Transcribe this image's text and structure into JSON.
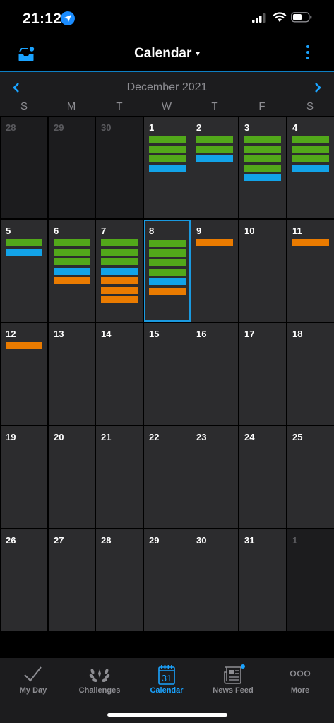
{
  "status": {
    "time": "21:12"
  },
  "header": {
    "title": "Calendar",
    "caret": "▾"
  },
  "calendar": {
    "month_label": "December 2021",
    "prev_icon": "chevron-left-icon",
    "next_icon": "chevron-right-icon",
    "weekdays": [
      "S",
      "M",
      "T",
      "W",
      "T",
      "F",
      "S"
    ],
    "selected_day": 8,
    "colors": {
      "green": "#52a81a",
      "blue": "#12a3e8",
      "orange": "#ea7b00"
    },
    "days": [
      {
        "label": "28",
        "other": true,
        "events": []
      },
      {
        "label": "29",
        "other": true,
        "events": []
      },
      {
        "label": "30",
        "other": true,
        "events": []
      },
      {
        "label": "1",
        "events": [
          "green",
          "green",
          "green",
          "blue"
        ]
      },
      {
        "label": "2",
        "events": [
          "green",
          "green",
          "blue"
        ]
      },
      {
        "label": "3",
        "events": [
          "green",
          "green",
          "green",
          "green",
          "blue"
        ]
      },
      {
        "label": "4",
        "events": [
          "green",
          "green",
          "green",
          "blue"
        ]
      },
      {
        "label": "5",
        "events": [
          "green",
          "blue"
        ]
      },
      {
        "label": "6",
        "events": [
          "green",
          "green",
          "green",
          "blue",
          "orange"
        ]
      },
      {
        "label": "7",
        "events": [
          "green",
          "green",
          "green",
          "blue",
          "orange",
          "orange",
          "orange"
        ]
      },
      {
        "label": "8",
        "selected": true,
        "events": [
          "green",
          "green",
          "green",
          "green",
          "blue",
          "orange"
        ]
      },
      {
        "label": "9",
        "events": [
          "orange"
        ]
      },
      {
        "label": "10",
        "events": []
      },
      {
        "label": "11",
        "events": [
          "orange"
        ]
      },
      {
        "label": "12",
        "events": [
          "orange"
        ]
      },
      {
        "label": "13",
        "events": []
      },
      {
        "label": "14",
        "events": []
      },
      {
        "label": "15",
        "events": []
      },
      {
        "label": "16",
        "events": []
      },
      {
        "label": "17",
        "events": []
      },
      {
        "label": "18",
        "events": []
      },
      {
        "label": "19",
        "events": []
      },
      {
        "label": "20",
        "events": []
      },
      {
        "label": "21",
        "events": []
      },
      {
        "label": "22",
        "events": []
      },
      {
        "label": "23",
        "events": []
      },
      {
        "label": "24",
        "events": []
      },
      {
        "label": "25",
        "events": []
      },
      {
        "label": "26",
        "events": []
      },
      {
        "label": "27",
        "events": []
      },
      {
        "label": "28",
        "events": []
      },
      {
        "label": "29",
        "events": []
      },
      {
        "label": "30",
        "events": []
      },
      {
        "label": "31",
        "events": []
      },
      {
        "label": "1",
        "other": true,
        "events": []
      }
    ]
  },
  "tabs": [
    {
      "label": "My Day",
      "icon": "checkmark-icon"
    },
    {
      "label": "Challenges",
      "icon": "laurel-icon"
    },
    {
      "label": "Calendar",
      "icon": "calendar-icon",
      "active": true,
      "icon_text": "31"
    },
    {
      "label": "News Feed",
      "icon": "newspaper-icon"
    },
    {
      "label": "More",
      "icon": "more-dots-icon"
    }
  ],
  "accent": "#1aa3ff"
}
